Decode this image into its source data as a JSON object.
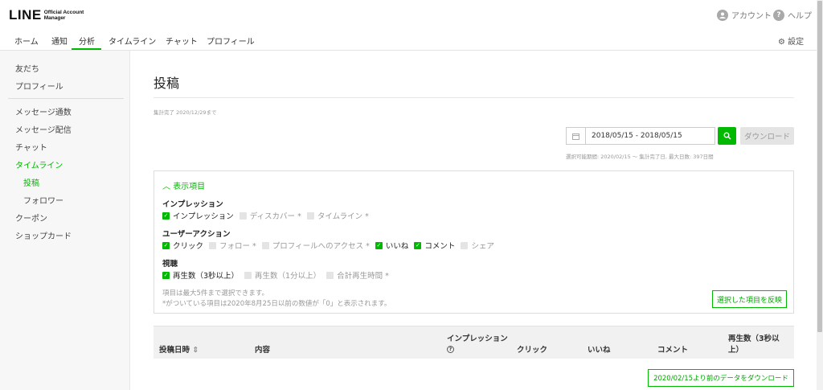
{
  "header": {
    "logo_main": "LINE",
    "logo_sub_1": "Official Account",
    "logo_sub_2": "Manager",
    "account_label": "アカウント",
    "help_label": "ヘルプ"
  },
  "nav": {
    "tabs": [
      {
        "label": "ホーム"
      },
      {
        "label": "通知"
      },
      {
        "label": "分析"
      },
      {
        "label": "タイムライン"
      },
      {
        "label": "チャット"
      },
      {
        "label": "プロフィール"
      }
    ],
    "active_tab": "分析",
    "settings_label": "設定"
  },
  "sidebar": {
    "items": [
      {
        "label": "友だち"
      },
      {
        "label": "プロフィール"
      },
      {
        "label": "メッセージ通数"
      },
      {
        "label": "メッセージ配信"
      },
      {
        "label": "チャット"
      },
      {
        "label": "タイムライン"
      },
      {
        "label": "投稿"
      },
      {
        "label": "フォロワー"
      },
      {
        "label": "クーポン"
      },
      {
        "label": "ショップカード"
      }
    ]
  },
  "main": {
    "title": "投稿",
    "aggregation_note": "集計完了 2020/12/29まで",
    "date_range": "2018/05/15 - 2018/05/15",
    "download_label": "ダウンロード",
    "range_note": "選択可能期間: 2020/02/15 ～ 集計完了日, 最大日数: 397日間",
    "panel": {
      "toggle_label": "表示項目",
      "groups": [
        {
          "title": "インプレッション",
          "options": [
            {
              "label": "インプレッション",
              "checked": true
            },
            {
              "label": "ディスカバー *",
              "checked": false
            },
            {
              "label": "タイムライン *",
              "checked": false
            }
          ]
        },
        {
          "title": "ユーザーアクション",
          "options": [
            {
              "label": "クリック",
              "checked": true
            },
            {
              "label": "フォロー *",
              "checked": false
            },
            {
              "label": "プロフィールへのアクセス *",
              "checked": false
            },
            {
              "label": "いいね",
              "checked": true
            },
            {
              "label": "コメント",
              "checked": true
            },
            {
              "label": "シェア",
              "checked": false
            }
          ]
        },
        {
          "title": "視聴",
          "options": [
            {
              "label": "再生数（3秒以上）",
              "checked": true
            },
            {
              "label": "再生数（1分以上）",
              "checked": false
            },
            {
              "label": "合計再生時間 *",
              "checked": false
            }
          ]
        }
      ],
      "hint_1": "項目は最大5件まで選択できます。",
      "hint_2": "*がついている項目は2020年8月25日以前の数値が「0」と表示されます。",
      "apply_label": "選択した項目を反映"
    },
    "table": {
      "columns": {
        "date": "投稿日時",
        "content": "内容",
        "impression": "インプレッション",
        "click": "クリック",
        "like": "いいね",
        "comment": "コメント",
        "plays_line1": "再生数（3秒以",
        "plays_line2": "上）"
      }
    },
    "download_before_label": "2020/02/15より前のデータをダウンロード"
  },
  "colors": {
    "accent": "#00b900"
  }
}
